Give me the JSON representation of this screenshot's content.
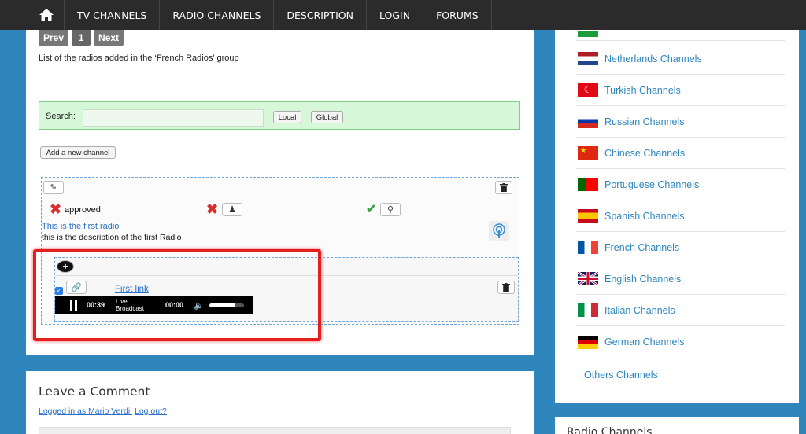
{
  "nav": {
    "items": [
      "TV CHANNELS",
      "RADIO CHANNELS",
      "DESCRIPTION",
      "LOGIN",
      "FORUMS"
    ]
  },
  "pager": {
    "prev": "Prev",
    "page": "1",
    "next": "Next"
  },
  "intro": "List of the radios added in the ‘French Radios’ group",
  "search": {
    "label": "Search:",
    "local": "Local",
    "global": "Global",
    "value": ""
  },
  "add_channel_label": "Add a new channel",
  "radio": {
    "status": "approved",
    "title": "This is the first radio",
    "description": "this is the description of the first Radio"
  },
  "link": {
    "checked": true,
    "label": "First link"
  },
  "player": {
    "elapsed": "00:39",
    "live_label": "Live Broadcast",
    "duration": "00:00",
    "volume_fraction": 0.75
  },
  "comment": {
    "title": "Leave a Comment",
    "logged_in_prefix": "Logged in as Mario Verdi.",
    "logout": "Log out?"
  },
  "sidebar": {
    "items": [
      {
        "label": "Netherlands Channels",
        "flag": "netherlands-flag-icon"
      },
      {
        "label": "Turkish Channels",
        "flag": "turkey-flag-icon"
      },
      {
        "label": "Russian Channels",
        "flag": "russia-flag-icon"
      },
      {
        "label": "Chinese Channels",
        "flag": "china-flag-icon"
      },
      {
        "label": "Portuguese Channels",
        "flag": "portugal-flag-icon"
      },
      {
        "label": "Spanish Channels",
        "flag": "spain-flag-icon"
      },
      {
        "label": "French Channels",
        "flag": "france-flag-icon"
      },
      {
        "label": "English Channels",
        "flag": "uk-flag-icon"
      },
      {
        "label": "Italian Channels",
        "flag": "italy-flag-icon"
      },
      {
        "label": "German Channels",
        "flag": "germany-flag-icon"
      }
    ],
    "others": "Others Channels",
    "section2_title": "Radio Channels"
  }
}
